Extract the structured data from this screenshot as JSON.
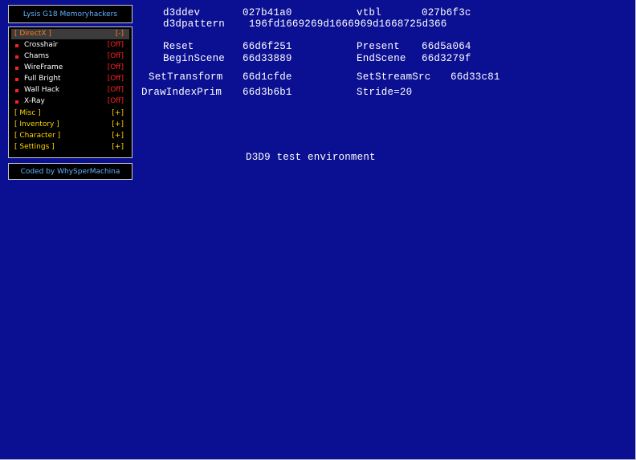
{
  "window": {
    "background": "#0b0f92"
  },
  "menu": {
    "title": "Lysis G18 Memoryhackers",
    "directx": {
      "label": "[ DirectX ]",
      "value": "[-]"
    },
    "items": [
      {
        "label": "Crosshair",
        "value": "[Off]"
      },
      {
        "label": "Chams",
        "value": "[Off]"
      },
      {
        "label": "WireFrame",
        "value": "[Off]"
      },
      {
        "label": "Full Bright",
        "value": "[Off]"
      },
      {
        "label": "Wall Hack",
        "value": "[Off]"
      },
      {
        "label": "X-Ray",
        "value": "[Off]"
      }
    ],
    "groups": [
      {
        "label": "[ Misc ]",
        "value": "[+]"
      },
      {
        "label": "[ Inventory ]",
        "value": "[+]"
      },
      {
        "label": "[ Character ]",
        "value": "[+]"
      },
      {
        "label": "[ Settings ]",
        "value": "[+]"
      }
    ],
    "credit": "Coded by WhySperMachina",
    "colors": {
      "title": "#5fb3ff",
      "selected": "#ff7a1a",
      "off": "#ff2020",
      "group": "#ffd400"
    }
  },
  "debug": {
    "d3ddev_label": "d3ddev",
    "d3ddev_value": "027b41a0",
    "vtbl_label": "vtbl",
    "vtbl_value": "027b6f3c",
    "d3dpattern_label": "d3dpattern",
    "d3dpattern_value": "196fd1669269d1666969d1668725d366",
    "reset_label": "Reset",
    "reset_value": "66d6f251",
    "present_label": "Present",
    "present_value": "66d5a064",
    "beginscene_label": "BeginScene",
    "beginscene_value": "66d33889",
    "endscene_label": "EndScene",
    "endscene_value": "66d3279f",
    "settransform_label": "SetTransform",
    "settransform_value": "66d1cfde",
    "setstreamsrc_label": "SetStreamSrc",
    "setstreamsrc_value": "66d33c81",
    "drawindexprim_label": "DrawIndexPrim",
    "drawindexprim_value": "66d3b6b1",
    "stride": "Stride=20",
    "env_title": "D3D9 test environment"
  }
}
